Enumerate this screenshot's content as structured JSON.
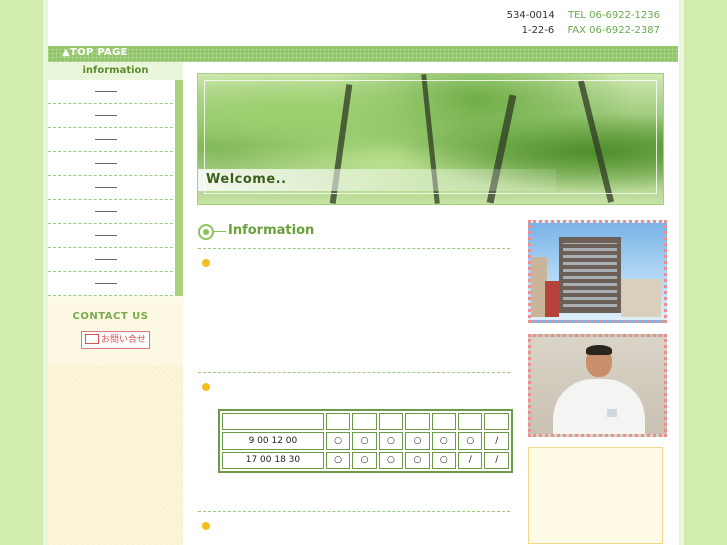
{
  "header": {
    "rows": [
      {
        "left": "534-0014",
        "right": "TEL 06-6922-1236"
      },
      {
        "left": "1-22-6",
        "right": "FAX 06-6922-2387"
      }
    ]
  },
  "topbar": {
    "link_label": "▲TOP PAGE"
  },
  "sidebar": {
    "heading": "information",
    "items": [
      "",
      "",
      "",
      "",
      "",
      "",
      "",
      "",
      ""
    ],
    "contact_title": "CONTACT US",
    "contact_button": "お問い合せ"
  },
  "banner": {
    "caption": "Welcome.."
  },
  "main": {
    "section_title": "Information",
    "hours_table": {
      "header": [
        "",
        "",
        "",
        "",
        "",
        "",
        "",
        ""
      ],
      "rows": [
        {
          "time": "9 00 12 00",
          "marks": [
            "○",
            "○",
            "○",
            "○",
            "○",
            "○",
            "/"
          ]
        },
        {
          "time": "17 00 18 30",
          "marks": [
            "○",
            "○",
            "○",
            "○",
            "○",
            "/",
            "/"
          ]
        }
      ]
    }
  },
  "colors": {
    "accent_green": "#8fc563",
    "bullet_yellow": "#f4bf1e",
    "photo_border": "#f08c8c",
    "page_bg": "#d9efb8"
  }
}
